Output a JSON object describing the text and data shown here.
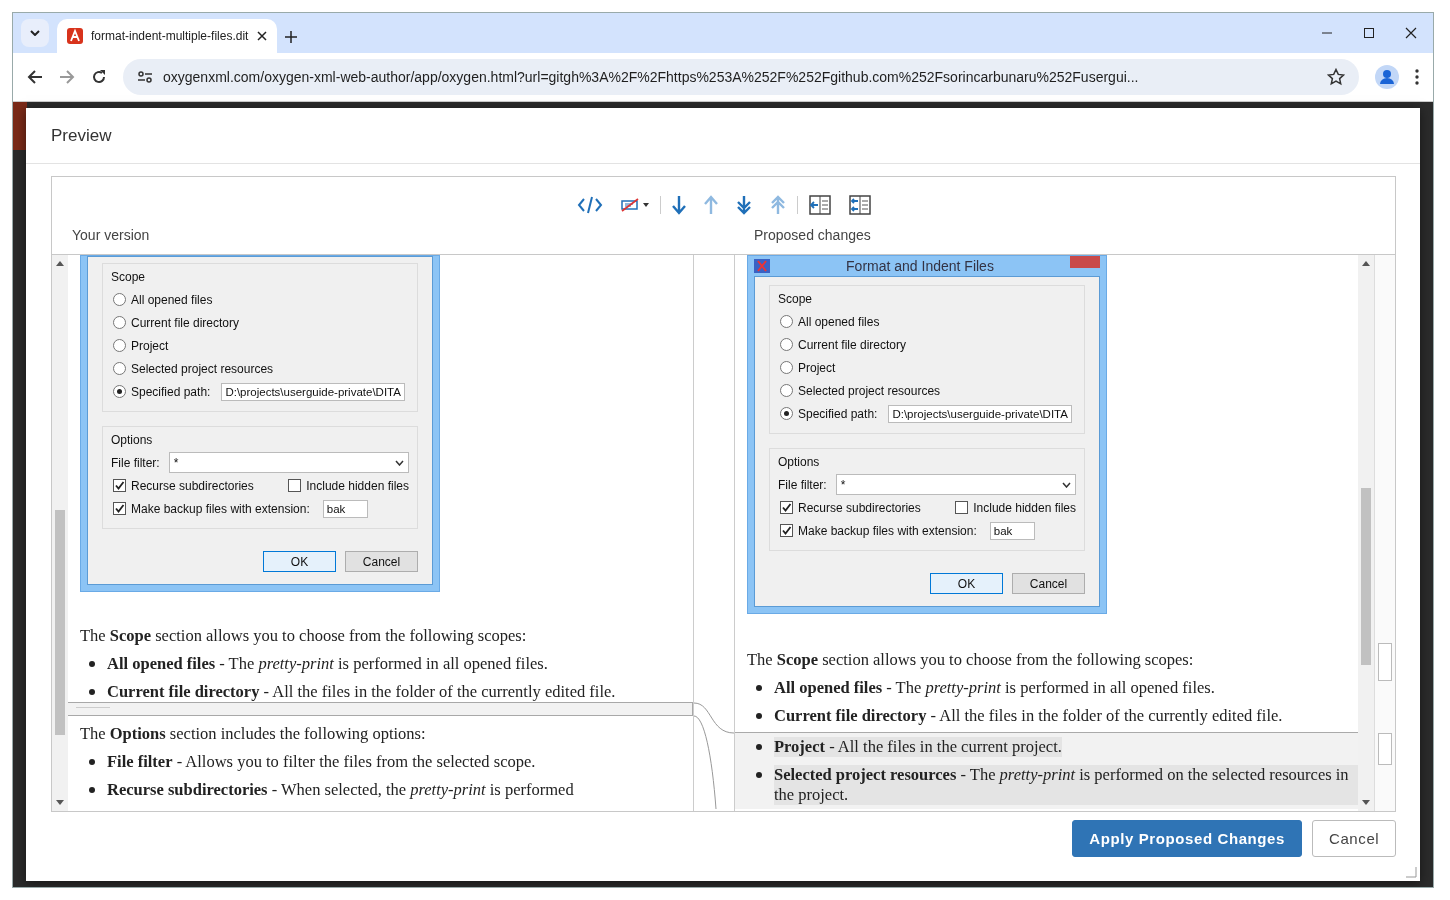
{
  "browser": {
    "tab_title": "format-indent-multiple-files.dit",
    "url": "oxygenxml.com/oxygen-xml-web-author/app/oxygen.html?url=gitgh%3A%2F%2Fhttps%253A%252F%252Fgithub.com%252Fsorincarbunaru%252Fusergui..."
  },
  "dialog": {
    "title": "Preview",
    "toolbar": [
      {
        "kind": "source",
        "disabled": false
      },
      {
        "kind": "hide",
        "disabled": false
      },
      {
        "kind": "next",
        "disabled": false
      },
      {
        "kind": "previous",
        "disabled": true
      },
      {
        "kind": "last",
        "disabled": false
      },
      {
        "kind": "first",
        "disabled": true
      },
      {
        "kind": "take-one",
        "disabled": false
      },
      {
        "kind": "take-all",
        "disabled": false
      }
    ],
    "panes": [
      {
        "label": "Your version",
        "embedded": {
          "scope_label": "Scope",
          "scope_options": [
            {
              "label": "All opened files",
              "selected": false
            },
            {
              "label": "Current file directory",
              "selected": false
            },
            {
              "label": "Project",
              "selected": false
            },
            {
              "label": "Selected project resources",
              "selected": false
            },
            {
              "label": "Specified path:",
              "selected": true
            }
          ],
          "path": "D:\\projects\\userguide-private\\DITA",
          "options_label": "Options",
          "filter_label": "File filter:",
          "filter_value": "*",
          "checkboxes": [
            {
              "label": "Recurse subdirectories",
              "checked": true
            },
            {
              "label": "Include hidden files",
              "checked": false
            },
            {
              "label": "Make backup files with extension:",
              "checked": true
            }
          ],
          "extension": "bak",
          "buttons": [
            "OK",
            "Cancel"
          ]
        },
        "blocks": [
          {
            "kind": "paragraph",
            "text": "The **Scope** section allows you to choose from the following scopes:",
            "changed": false
          },
          {
            "kind": "bullet",
            "text": "**All opened files** - The *pretty-print* is performed in all opened files.",
            "changed": false
          },
          {
            "kind": "bullet",
            "text": "**Current file directory** - All the files in the folder of the currently edited file.",
            "changed": false
          },
          {
            "kind": "insertion-point"
          },
          {
            "kind": "paragraph",
            "text": "The **Options** section includes the following options:",
            "changed": false
          },
          {
            "kind": "bullet",
            "text": "**File filter** - Allows you to filter the files from the selected scope.",
            "changed": false
          },
          {
            "kind": "bullet",
            "text": "**Recurse subdirectories** - When selected, the *pretty-print* is performed",
            "changed": false
          }
        ]
      },
      {
        "label": "Proposed changes",
        "embedded": {
          "title": "Format and Indent Files",
          "scope_label": "Scope",
          "scope_options": [
            {
              "label": "All opened files",
              "selected": false
            },
            {
              "label": "Current file directory",
              "selected": false
            },
            {
              "label": "Project",
              "selected": false
            },
            {
              "label": "Selected project resources",
              "selected": false
            },
            {
              "label": "Specified path:",
              "selected": true
            }
          ],
          "path": "D:\\projects\\userguide-private\\DITA",
          "options_label": "Options",
          "filter_label": "File filter:",
          "filter_value": "*",
          "checkboxes": [
            {
              "label": "Recurse subdirectories",
              "checked": true
            },
            {
              "label": "Include hidden files",
              "checked": false
            },
            {
              "label": "Make backup files with extension:",
              "checked": true
            }
          ],
          "extension": "bak",
          "buttons": [
            "OK",
            "Cancel"
          ]
        },
        "blocks": [
          {
            "kind": "paragraph",
            "text": "The **Scope** section allows you to choose from the following scopes:",
            "changed": false
          },
          {
            "kind": "bullet",
            "text": "**All opened files** - The *pretty-print* is performed in all opened files.",
            "changed": false
          },
          {
            "kind": "bullet",
            "text": "**Current file directory** - All the files in the folder of the currently edited file.",
            "changed": false
          },
          {
            "kind": "bullet",
            "text": "**Project** - All the files in the current project.",
            "changed": true
          },
          {
            "kind": "bullet",
            "text": "**Selected project resources** - The *pretty-print* is performed on the selected resources in the project.",
            "changed": true
          }
        ]
      }
    ],
    "buttons": [
      {
        "label": "Apply Proposed Changes",
        "kind": "primary"
      },
      {
        "label": "Cancel",
        "kind": "secondary"
      }
    ]
  }
}
